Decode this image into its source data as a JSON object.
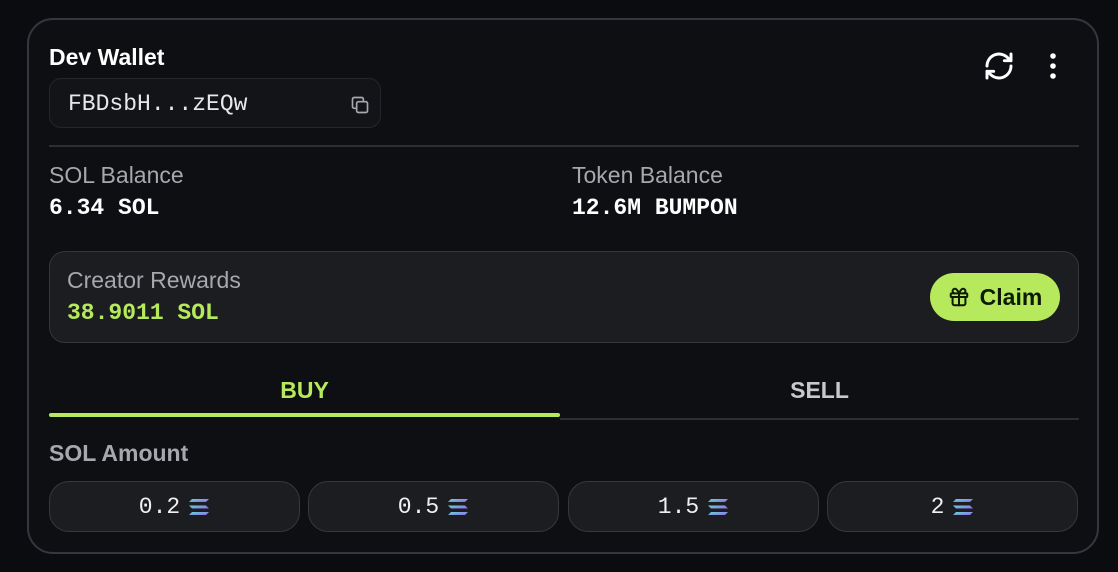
{
  "wallet": {
    "title": "Dev Wallet",
    "address": "FBDsbH...zEQw",
    "icons": [
      "copy-icon",
      "refresh-icon",
      "more-vertical-icon"
    ]
  },
  "balances": {
    "sol_label": "SOL Balance",
    "sol_value": "6.34 SOL",
    "token_label": "Token Balance",
    "token_value": "12.6M BUMPON"
  },
  "rewards": {
    "label": "Creator Rewards",
    "value": "38.9011 SOL",
    "claim_label": "Claim",
    "claim_icon": "gift-icon"
  },
  "tabs": [
    {
      "label": "BUY",
      "active": true
    },
    {
      "label": "SELL",
      "active": false
    }
  ],
  "amount": {
    "label": "SOL Amount",
    "presets": [
      "0.2",
      "0.5",
      "1.5",
      "2"
    ],
    "preset_icon": "solana-icon"
  },
  "colors": {
    "accent": "#b6ea5c",
    "background": "#0d0f13",
    "panel": "#1c1d20",
    "muted_text": "#a6a8ad"
  }
}
